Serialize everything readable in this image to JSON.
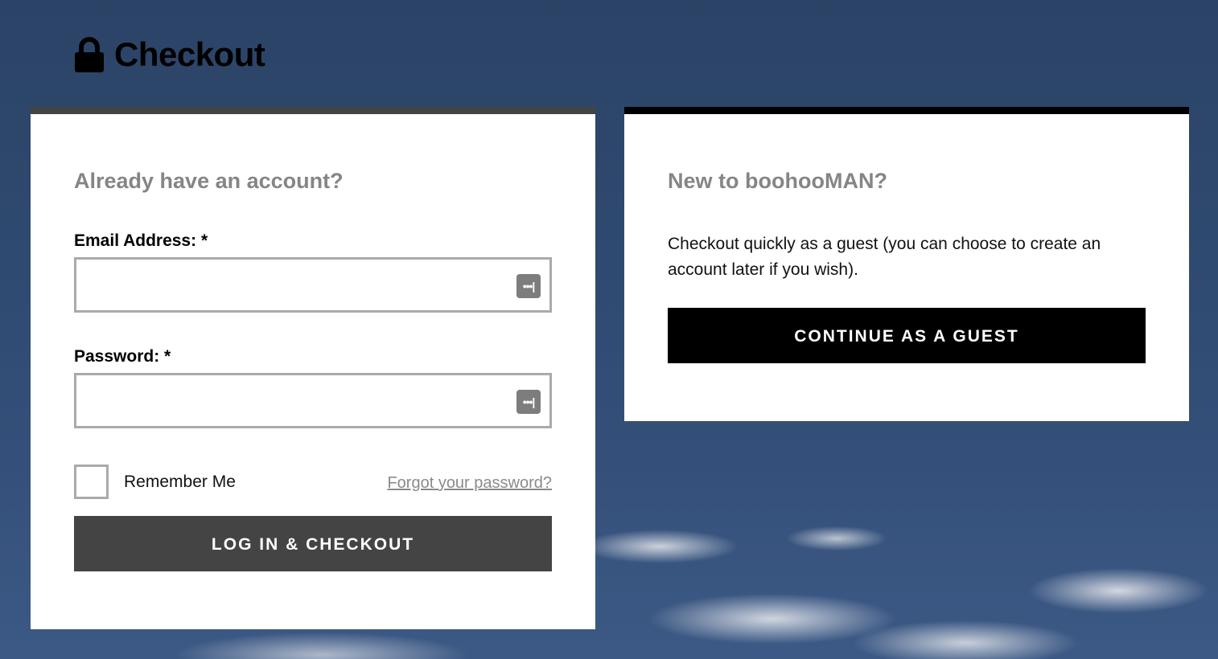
{
  "header": {
    "title": "Checkout",
    "icon": "lock-icon"
  },
  "login": {
    "heading": "Already have an account?",
    "email_label": "Email Address: *",
    "email_value": "",
    "password_label": "Password: *",
    "password_value": "",
    "pw_manager_icon": "•••|",
    "remember_label": "Remember Me",
    "remember_checked": false,
    "forgot_link": "Forgot your password?",
    "submit_label": "LOG IN & CHECKOUT"
  },
  "guest": {
    "heading": "New to boohooMAN?",
    "description": "Checkout quickly as a guest (you can choose to create an account later if you wish).",
    "button_label": "CONTINUE AS A GUEST"
  },
  "colors": {
    "login_button": "#444444",
    "guest_button": "#000000",
    "heading_gray": "#858585"
  }
}
